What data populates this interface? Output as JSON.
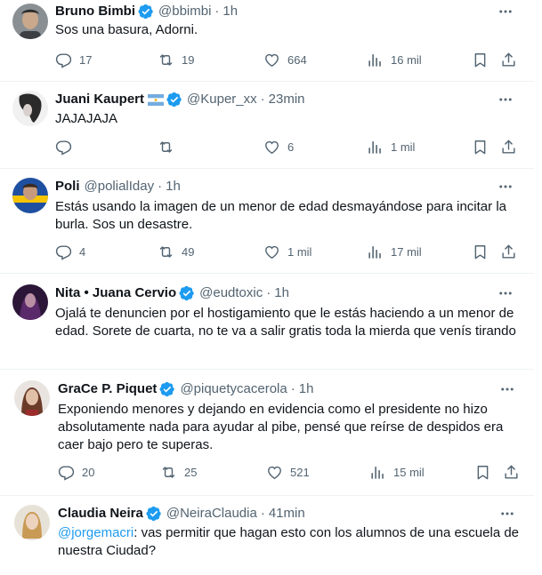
{
  "tweets": [
    {
      "name": "Bruno Bimbi",
      "handle": "@bbimbi",
      "time": "1h",
      "text": "Sos una basura, Adorni.",
      "replies": "17",
      "retweets": "19",
      "likes": "664",
      "views": "16 mil"
    },
    {
      "name": "Juani Kaupert",
      "handle": "@Kuper_xx",
      "time": "23min",
      "text": "JAJAJAJA",
      "replies": "",
      "retweets": "",
      "likes": "6",
      "views": "1 mil"
    },
    {
      "name": "Poli",
      "handle": "@polialIday",
      "time": "1h",
      "text": "Estás usando la imagen de un menor de edad desmayándose para incitar la burla. Sos un desastre.",
      "replies": "4",
      "retweets": "49",
      "likes": "1 mil",
      "views": "17 mil"
    },
    {
      "name": "Nita • Juana Cervio",
      "handle": "@eudtoxic",
      "time": "1h",
      "text": "Ojalá te denuncien por el hostigamiento que le estás haciendo a un menor de edad. Sorete de cuarta, no te va a salir gratis toda la mierda que venís tirando"
    },
    {
      "name": "GraCe P. Piquet",
      "handle": "@piquetycacerola",
      "time": "1h",
      "text": "Exponiendo menores y dejando en evidencia como el presidente no hizo absolutamente nada para ayudar al pibe, pensé que reírse de despidos era caer bajo pero te superas.",
      "replies": "20",
      "retweets": "25",
      "likes": "521",
      "views": "15 mil"
    },
    {
      "name": "Claudia Neira",
      "handle": "@NeiraClaudia",
      "time": "41min",
      "mention": "@jorgemacri",
      "text": ": vas permitir que hagan esto con los alumnos de una escuela de nuestra Ciudad?"
    }
  ],
  "separator": "·",
  "icons": {
    "verified": "verified-badge-icon",
    "flag": "argentina-flag-icon",
    "more": "more-options-icon",
    "reply": "reply-icon",
    "retweet": "retweet-icon",
    "like": "heart-icon",
    "views": "views-chart-icon",
    "bookmark": "bookmark-icon",
    "share": "share-icon"
  },
  "colors": {
    "text": "#0f1419",
    "secondary": "#536471",
    "verified": "#1d9bf0",
    "mention": "#1d9bf0",
    "divider": "#eff3f4"
  }
}
